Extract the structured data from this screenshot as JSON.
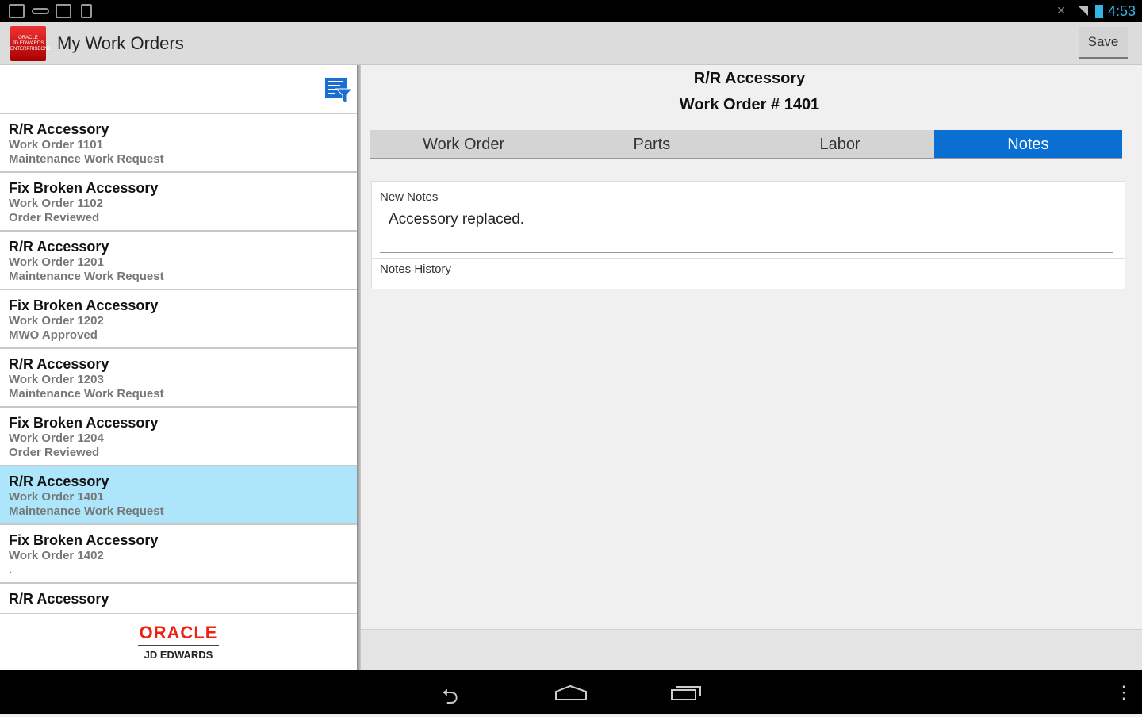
{
  "status": {
    "time": "4:53",
    "icons": [
      "image-icon",
      "key-icon",
      "gmail-icon",
      "download-icon",
      "mute-icon",
      "wifi-icon",
      "battery-icon"
    ]
  },
  "appbar": {
    "title": "My Work Orders",
    "save_label": "Save",
    "logo_text": "ORACLE JD EDWARDS ENTERPRISEONE"
  },
  "list": {
    "items": [
      {
        "title": "R/R Accessory",
        "order": "Work Order 1101",
        "status": "Maintenance Work Request"
      },
      {
        "title": "Fix Broken Accessory",
        "order": "Work Order 1102",
        "status": "Order Reviewed"
      },
      {
        "title": "R/R Accessory",
        "order": "Work Order 1201",
        "status": "Maintenance Work Request"
      },
      {
        "title": "Fix Broken Accessory",
        "order": "Work Order 1202",
        "status": "MWO Approved"
      },
      {
        "title": "R/R Accessory",
        "order": "Work Order 1203",
        "status": "Maintenance Work Request"
      },
      {
        "title": "Fix Broken Accessory",
        "order": "Work Order 1204",
        "status": "Order Reviewed"
      },
      {
        "title": "R/R Accessory",
        "order": "Work Order 1401",
        "status": "Maintenance Work Request",
        "selected": true
      },
      {
        "title": "Fix Broken Accessory",
        "order": "Work Order 1402",
        "status": "."
      },
      {
        "title": "R/R Accessory",
        "order": "",
        "status": ""
      }
    ]
  },
  "footer": {
    "brand": "ORACLE",
    "sub": "JD EDWARDS"
  },
  "detail": {
    "title": "R/R Accessory",
    "work_order": "Work Order # 1401",
    "tabs": [
      "Work Order",
      "Parts",
      "Labor",
      "Notes"
    ],
    "active_tab": "Notes",
    "new_notes_label": "New Notes",
    "new_notes_value": "Accessory replaced.",
    "history_label": "Notes History"
  },
  "colors": {
    "accent": "#0a6fd2",
    "selected": "#ade6fa",
    "clock": "#33b5e5",
    "brand": "#e21111"
  }
}
